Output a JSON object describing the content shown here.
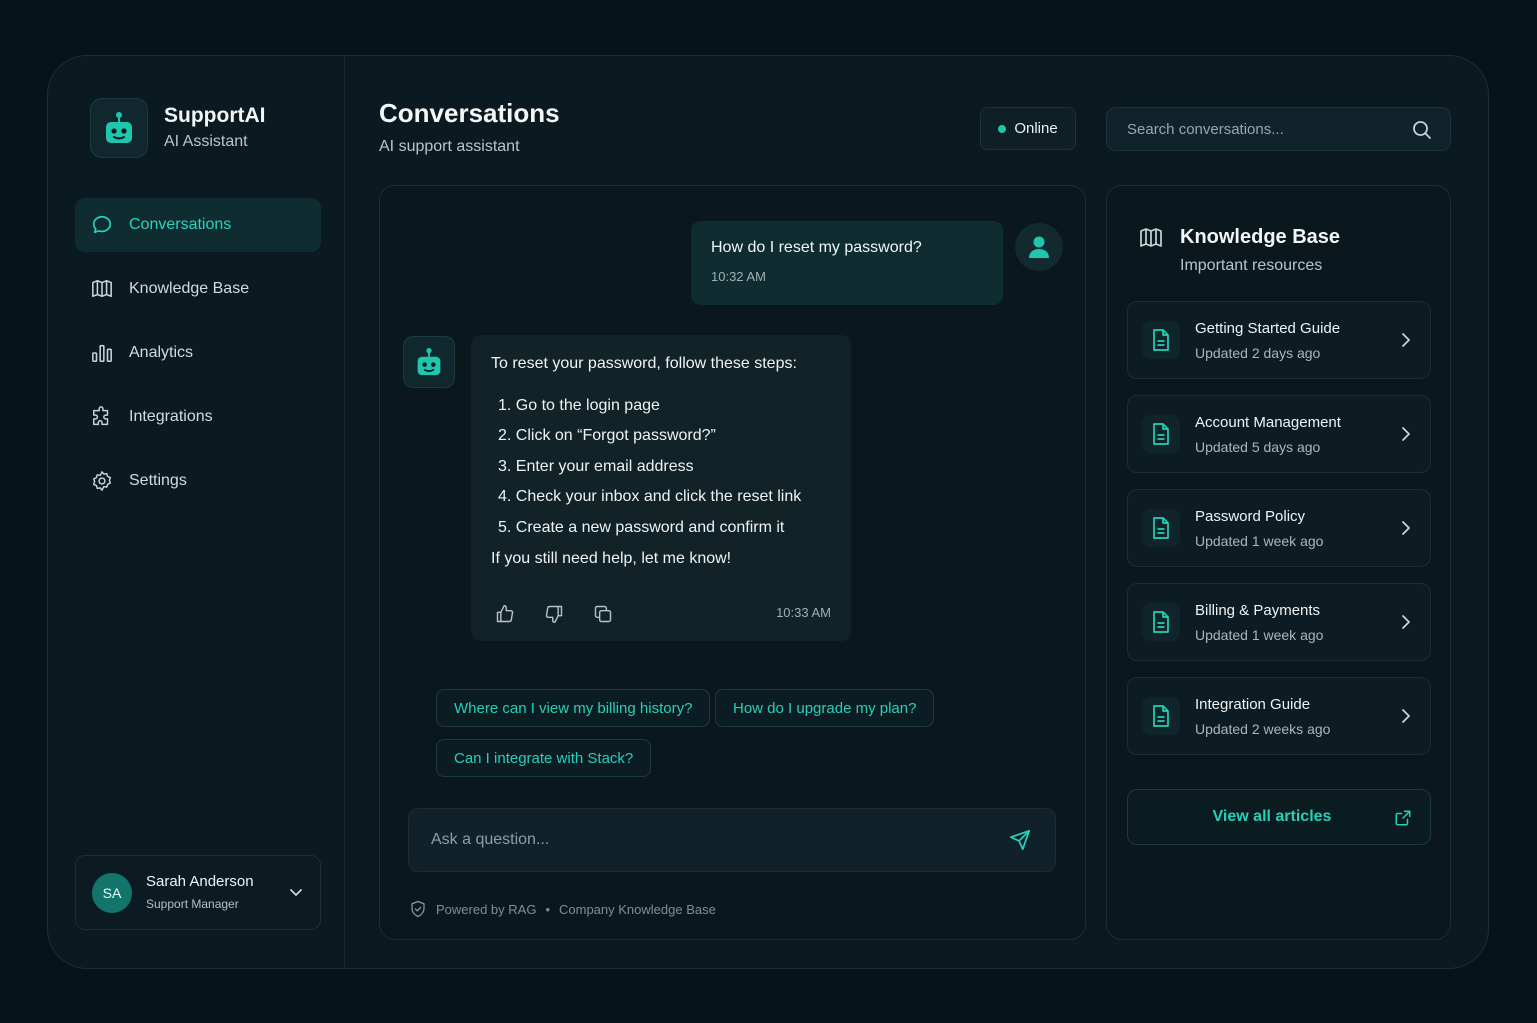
{
  "brand": {
    "name": "SupportAI",
    "subtitle": "AI Assistant"
  },
  "sidebar": {
    "items": [
      {
        "label": "Conversations",
        "icon": "chat-bubble-icon",
        "active": true
      },
      {
        "label": "Knowledge Base",
        "icon": "book-icon",
        "active": false
      },
      {
        "label": "Analytics",
        "icon": "bar-chart-icon",
        "active": false
      },
      {
        "label": "Integrations",
        "icon": "puzzle-icon",
        "active": false
      },
      {
        "label": "Settings",
        "icon": "gear-icon",
        "active": false
      }
    ]
  },
  "user": {
    "initials": "SA",
    "name": "Sarah Anderson",
    "role": "Support Manager"
  },
  "header": {
    "title": "Conversations",
    "subtitle": "AI support assistant",
    "status": "Online",
    "search_placeholder": "Search conversations..."
  },
  "chat": {
    "user_message": {
      "text": "How do I reset my password?",
      "time": "10:32 AM"
    },
    "bot_message": {
      "intro": "To reset your password, follow these steps:",
      "steps": [
        "1. Go to the login page",
        "2. Click on “Forgot password?”",
        "3. Enter your email address",
        "4. Check your inbox and click the reset link",
        "5. Create a new password and confirm it"
      ],
      "outro": "If you still need help, let me know!",
      "time": "10:33 AM"
    },
    "suggestions": [
      "Where can I view my billing history?",
      "How do I upgrade my plan?",
      "Can I integrate with Stack?"
    ],
    "input_placeholder": "Ask a question...",
    "footer": {
      "powered": "Powered by RAG",
      "separator": "•",
      "source": "Company Knowledge Base"
    }
  },
  "knowledge_base": {
    "title": "Knowledge Base",
    "subtitle": "Important resources",
    "articles": [
      {
        "name": "Getting Started Guide",
        "updated": "Updated 2 days ago"
      },
      {
        "name": "Account Management",
        "updated": "Updated 5 days ago"
      },
      {
        "name": "Password Policy",
        "updated": "Updated 1 week ago"
      },
      {
        "name": "Billing & Payments",
        "updated": "Updated 1 week ago"
      },
      {
        "name": "Integration Guide",
        "updated": "Updated 2 weeks ago"
      }
    ],
    "view_all": "View all articles"
  },
  "colors": {
    "accent": "#27cfb9",
    "background": "#07131a",
    "panel": "#0b1a20",
    "status_online": "#1fc6ae"
  }
}
